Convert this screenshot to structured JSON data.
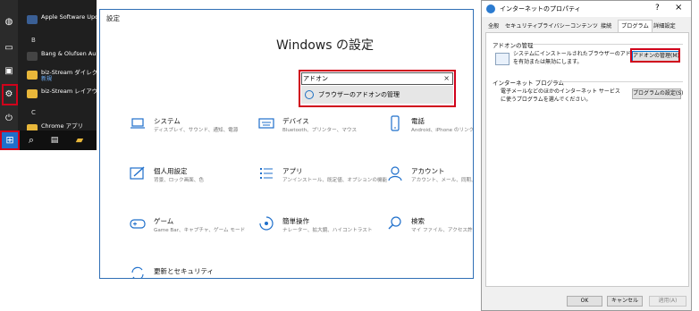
{
  "start_menu": {
    "letter_b": "B",
    "letter_c": "C",
    "items": [
      {
        "label": "Apple Software Upd",
        "sub": ""
      },
      {
        "label": "Bang & Olufsen Au",
        "sub": ""
      },
      {
        "label": "biz-Stream ダイレクト",
        "sub": "新規"
      },
      {
        "label": "biz-Stream レイアウト",
        "sub": ""
      },
      {
        "label": "Chrome アプリ",
        "sub": ""
      }
    ]
  },
  "settings": {
    "window_title": "設定",
    "heading": "Windows の設定",
    "search": {
      "value": "アドオン",
      "clear": "×",
      "suggestion": "ブラウザーのアドオンの管理"
    },
    "tiles": [
      {
        "title": "システム",
        "desc": "ディスプレイ、サウンド、通知、電源"
      },
      {
        "title": "デバイス",
        "desc": "Bluetooth、プリンター、マウス"
      },
      {
        "title": "電話",
        "desc": "Android、iPhone のリンク"
      },
      {
        "title": "個人用設定",
        "desc": "背景、ロック画面、色"
      },
      {
        "title": "アプリ",
        "desc": "アンインストール、既定値、オプションの機能"
      },
      {
        "title": "アカウント",
        "desc": "アカウント、メール、同期、職場、他のユーザー"
      },
      {
        "title": "ゲーム",
        "desc": "Game Bar、キャプチャ、ゲーム モード"
      },
      {
        "title": "簡単操作",
        "desc": "ナレーター、拡大鏡、ハイコントラスト"
      },
      {
        "title": "検索",
        "desc": "マイ ファイル、アクセス許可"
      },
      {
        "title": "更新とセキュリティ",
        "desc": ""
      }
    ]
  },
  "props": {
    "title": "インターネットのプロパティ",
    "help": "?",
    "close": "×",
    "tabs": [
      "全般",
      "セキュリティ",
      "プライバシー",
      "コンテンツ",
      "接続",
      "プログラム",
      "詳細設定"
    ],
    "addon_group": {
      "title": "アドオンの管理",
      "desc1": "システムにインストールされたブラウザーのアドオン",
      "desc2": "を有効または無効にします。",
      "button": "アドオンの管理(M)"
    },
    "programs_group": {
      "title": "インターネット プログラム",
      "desc1": "電子メールなどのほかのインターネット サービス",
      "desc2": "に使うプログラムを選んでください。",
      "button": "プログラムの設定(S)"
    },
    "footer": {
      "ok": "OK",
      "cancel": "キャンセル",
      "apply": "適用(A)"
    }
  },
  "colors": {
    "highlight_red": "#d0021b",
    "accent_blue": "#1e6fcb"
  }
}
